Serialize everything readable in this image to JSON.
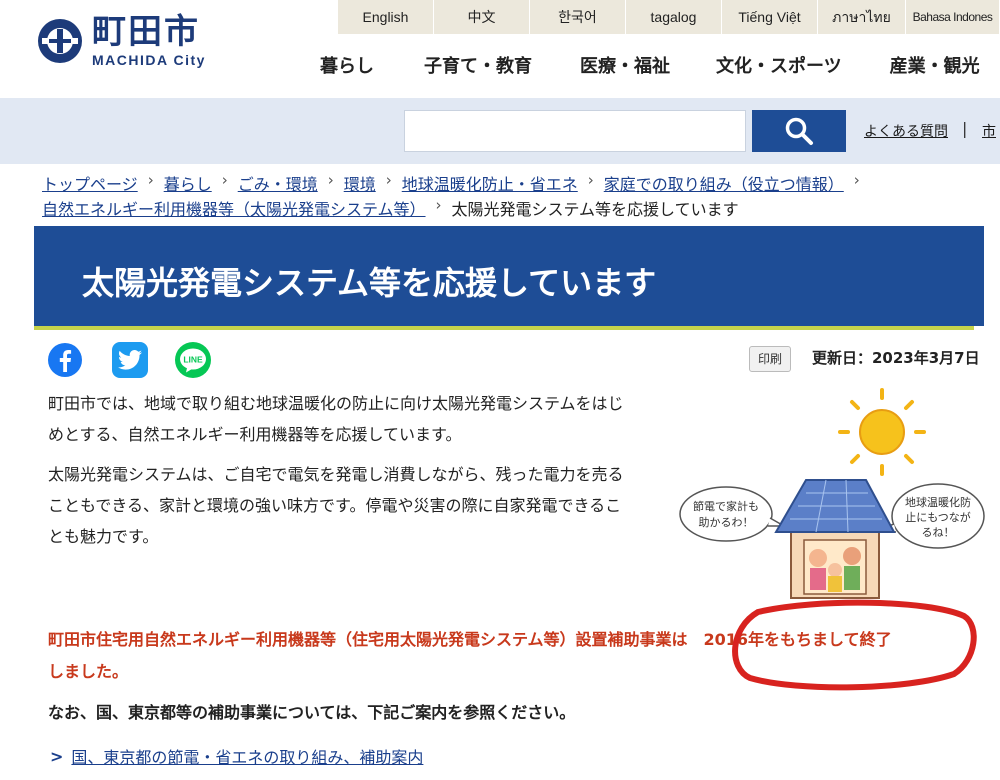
{
  "header": {
    "logo_kanji": "町田市",
    "logo_roman": "MACHIDA City",
    "languages": [
      "English",
      "中文",
      "한국어",
      "tagalog",
      "Tiếng Việt",
      "ภาษาไทย",
      "Bahasa Indones"
    ],
    "gnav": [
      "暮らし",
      "子育て・教育",
      "医療・福祉",
      "文化・スポーツ",
      "産業・観光"
    ]
  },
  "search": {
    "placeholder": "",
    "faq_label": "よくある質問",
    "separator": "|",
    "next_label": "市"
  },
  "breadcrumb": {
    "items": [
      "トップページ",
      "暮らし",
      "ごみ・環境",
      "環境",
      "地球温暖化防止・省エネ",
      "家庭での取り組み（役立つ情報）",
      "自然エネルギー利用機器等（太陽光発電システム等）"
    ],
    "current": "太陽光発電システム等を応援しています",
    "sep": "›"
  },
  "page": {
    "title": "太陽光発電システム等を応援しています",
    "print_label": "印刷",
    "updated": "更新日：2023年3月7日",
    "para1_line1": "町田市では、地域で取り組む地球温暖化の防止に向け太陽光発電システムをはじ",
    "para1_line2": "めとする、自然エネルギー利用機器等を応援しています。",
    "para2_line1": "太陽光発電システムは、ご自宅で電気を発電し消費しながら、残った電力を売る",
    "para2_line2": "こともできる、家計と環境の強い味方です。停電や災害の際に自家発電できるこ",
    "para2_line3": "とも魅力です。",
    "notice_line1": "町田市住宅用自然エネルギー利用機器等（住宅用太陽光発電システム等）設置補助事業は　2016年をもちまして終了",
    "notice_line2": "しました。",
    "note2": "なお、国、東京都等の補助事業については、下記ご案内を参照ください。",
    "link_label": "国、東京都の節電・省エネの取り組み、補助案内",
    "bubble_left_1": "節電で家計も",
    "bubble_left_2": "助かるわ！",
    "bubble_right_1": "地球温暖化防",
    "bubble_right_2": "止にもつなが",
    "bubble_right_3": "るね！"
  },
  "colors": {
    "brand_blue": "#1e4d96",
    "notice_red": "#c8391c",
    "accent_green": "#c5d34a",
    "circle_red": "#d8231f"
  }
}
